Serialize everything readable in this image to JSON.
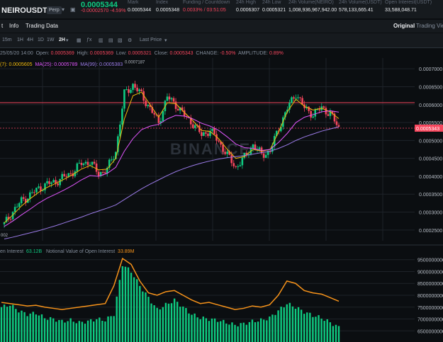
{
  "header": {
    "symbol": "NEIROUSDT",
    "contract_type": "Perp",
    "last_price": "0.0005344",
    "change": "-0.00002570 -4.59%",
    "stats": [
      {
        "label": "Mark",
        "value": "0.0005344"
      },
      {
        "label": "Index",
        "value": "0.0005348"
      },
      {
        "label": "Funding / Countdown",
        "value": "0.0033% / 03:51:05",
        "red": true
      },
      {
        "label": "24h High",
        "value": "0.0006307"
      },
      {
        "label": "24h Low",
        "value": "0.0005321"
      },
      {
        "label": "24h Volume(NEIRO)",
        "value": "1,008,936,967,942.00"
      },
      {
        "label": "24h Volume(USDT)",
        "value": "578,133,665.41"
      },
      {
        "label": "Open Interest(USDT)",
        "value": "33,588,048.71"
      }
    ]
  },
  "tabs": {
    "items": [
      "t",
      "Info",
      "Trading Data"
    ],
    "right_items": [
      "Original",
      "Trading View"
    ]
  },
  "toolbar": {
    "timeframes": [
      "15m",
      "1H",
      "4H",
      "1D",
      "1W",
      "2H"
    ],
    "active_timeframe": "2H",
    "price_type": "Last Price"
  },
  "legend": {
    "date": "25/05/20 14:00",
    "open_label": "Open:",
    "open": "0.0005369",
    "high_label": "High:",
    "high": "0.0005369",
    "low_label": "Low:",
    "low": "0.0005321",
    "close_label": "Close:",
    "close": "0.0005343",
    "change_label": "CHANGE:",
    "change": "-0.50%",
    "amplitude_label": "AMPLITUDE:",
    "amplitude": "0.89%",
    "ma7": "(7): 0.0005605",
    "ma25": "MA(25): 0.0005789",
    "ma99": "MA(99): 0.0005383"
  },
  "price_axis": [
    "0.0007000",
    "0.0006500",
    "0.0006000",
    "0.0005500",
    "0.0005000",
    "0.0004500",
    "0.0004000",
    "0.0003500",
    "0.0003000",
    "0.0002500"
  ],
  "current_price_tag": "0.0005343",
  "high_marker": "0.0007187",
  "low_marker": "002",
  "watermark": "BINANCE",
  "oi_legend": {
    "label": "en Interest",
    "value": "63.12B",
    "notional_label": "Notional Value of Open Interest",
    "notional_value": "33.89M"
  },
  "oi_axis": [
    "9500000000",
    "9000000000",
    "8500000000",
    "8000000000",
    "7500000000",
    "7000000000",
    "6500000000"
  ],
  "colors": {
    "up": "#0ecb81",
    "down": "#f6465d",
    "ma7": "#f0b90b",
    "ma25": "#e056fd",
    "ma99": "#9b7be8",
    "oi_bar": "#0ecb81",
    "notional_line": "#f7931a"
  },
  "chart_data": [
    {
      "type": "line",
      "title": "",
      "xlabel": "",
      "ylabel": "",
      "ylim": [
        0.00022,
        0.00073
      ],
      "grid": true,
      "x": [
        0,
        1,
        2,
        3,
        4,
        5,
        6,
        7,
        8,
        9,
        10,
        11,
        12,
        13,
        14,
        15,
        16,
        17,
        18,
        19,
        20,
        21,
        22,
        23,
        24,
        25,
        26,
        27,
        28,
        29,
        30,
        31,
        32,
        33,
        34,
        35,
        36,
        37,
        38,
        39
      ],
      "series": [
        {
          "name": "Price",
          "values": [
            0.000266,
            0.000302,
            0.000331,
            0.000348,
            0.000366,
            0.000378,
            0.000385,
            0.000398,
            0.000412,
            0.000436,
            0.00044,
            0.000407,
            0.00042,
            0.00047,
            0.00063,
            0.000655,
            0.000627,
            0.000589,
            0.00055,
            0.000621,
            0.0006,
            0.00057,
            0.000547,
            0.000515,
            0.000528,
            0.000497,
            0.000458,
            0.000425,
            0.000452,
            0.000488,
            0.00046,
            0.00047,
            0.000535,
            0.000589,
            0.000632,
            0.00059,
            0.000573,
            0.000591,
            0.000575,
            0.000534
          ]
        },
        {
          "name": "MA(7)",
          "values": [
            0.00027,
            0.000292,
            0.000317,
            0.000337,
            0.000355,
            0.000369,
            0.00038,
            0.000392,
            0.000405,
            0.00042,
            0.00043,
            0.000418,
            0.00042,
            0.00045,
            0.00056,
            0.000625,
            0.000635,
            0.0006,
            0.000565,
            0.000605,
            0.000603,
            0.000578,
            0.000555,
            0.000528,
            0.000525,
            0.000505,
            0.000475,
            0.00045,
            0.000455,
            0.000475,
            0.00047,
            0.000475,
            0.000525,
            0.00058,
            0.000615,
            0.000595,
            0.000585,
            0.00059,
            0.00058,
            0.000561
          ]
        },
        {
          "name": "MA(25)",
          "values": [
            0.00026,
            0.000275,
            0.000292,
            0.000308,
            0.000325,
            0.000339,
            0.00035,
            0.000362,
            0.000375,
            0.00039,
            0.000402,
            0.0004,
            0.000408,
            0.000425,
            0.00047,
            0.000505,
            0.00053,
            0.00054,
            0.000545,
            0.00056,
            0.00057,
            0.000568,
            0.00056,
            0.000548,
            0.00054,
            0.000528,
            0.00051,
            0.00049,
            0.00048,
            0.000478,
            0.000472,
            0.000475,
            0.000495,
            0.00052,
            0.00055,
            0.000565,
            0.000572,
            0.00058,
            0.000583,
            0.000579
          ]
        },
        {
          "name": "MA(99)",
          "values": [
            0.000225,
            0.00023,
            0.000236,
            0.000242,
            0.000248,
            0.000255,
            0.000262,
            0.00027,
            0.000278,
            0.000286,
            0.000295,
            0.000303,
            0.000311,
            0.00032,
            0.000335,
            0.00035,
            0.000365,
            0.000378,
            0.00039,
            0.000402,
            0.000413,
            0.000422,
            0.00043,
            0.000437,
            0.000443,
            0.000448,
            0.000452,
            0.000455,
            0.000458,
            0.000462,
            0.000466,
            0.00047,
            0.000478,
            0.000488,
            0.0005,
            0.00051,
            0.000518,
            0.000526,
            0.000532,
            0.000538
          ]
        }
      ],
      "horizontal_line": 0.0006055
    },
    {
      "type": "bar",
      "title": "",
      "ylim": [
        6300000000,
        9700000000
      ],
      "series": [
        {
          "name": "Open Interest",
          "values": [
            7500000000,
            7600000000,
            7350000000,
            7200000000,
            7250000000,
            7050000000,
            7000000000,
            6900000000,
            6950000000,
            6850000000,
            6900000000,
            7000000000,
            6950000000,
            7200000000,
            9300000000,
            9000000000,
            8400000000,
            7900000000,
            7400000000,
            7600000000,
            7800000000,
            7500000000,
            7200000000,
            7050000000,
            7000000000,
            6950000000,
            6850000000,
            6750000000,
            6800000000,
            6900000000,
            6950000000,
            7050000000,
            7350000000,
            7650000000,
            7500000000,
            7300000000,
            7150000000,
            7050000000,
            6850000000,
            6650000000
          ]
        },
        {
          "name": "Notional Value of Open Interest",
          "values": [
            7700000000,
            7650000000,
            7600000000,
            7550000000,
            7580000000,
            7500000000,
            7450000000,
            7400000000,
            7450000000,
            7500000000,
            7550000000,
            7600000000,
            7650000000,
            8400000000,
            9550000000,
            9300000000,
            8600000000,
            8100000000,
            8000000000,
            8150000000,
            8200000000,
            8000000000,
            7800000000,
            7650000000,
            7700000000,
            7600000000,
            7500000000,
            7400000000,
            7450000000,
            7550000000,
            7500000000,
            7600000000,
            8000000000,
            8600000000,
            8500000000,
            8200000000,
            8100000000,
            8050000000,
            7900000000,
            7750000000
          ]
        }
      ]
    }
  ]
}
